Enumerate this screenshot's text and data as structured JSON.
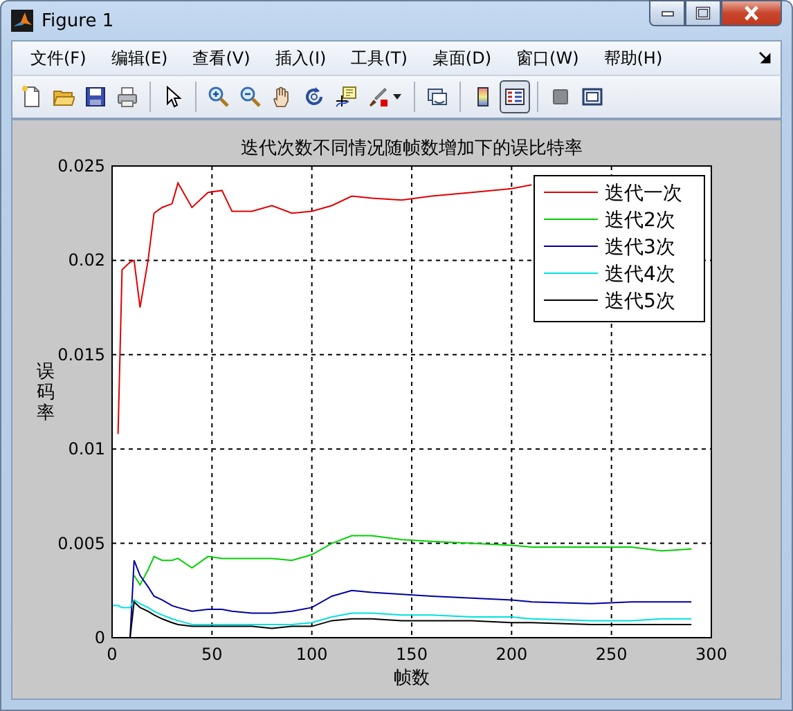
{
  "window": {
    "title": "Figure 1"
  },
  "menu": [
    "文件(F)",
    "编辑(E)",
    "查看(V)",
    "插入(I)",
    "工具(T)",
    "桌面(D)",
    "窗口(W)",
    "帮助(H)"
  ],
  "toolbar": [
    {
      "pressed": false
    },
    {
      "pressed": false
    },
    {
      "pressed": false
    },
    {
      "pressed": false
    },
    {
      "pressed": false
    },
    {
      "pressed": false
    },
    {
      "pressed": false
    },
    {
      "pressed": false
    },
    {
      "pressed": false
    },
    {
      "pressed": false
    },
    {
      "pressed": false
    },
    {
      "pressed": false
    },
    {
      "pressed": false
    },
    {
      "pressed": true
    },
    {
      "pressed": false
    },
    {
      "pressed": false
    }
  ],
  "axes": {
    "chart_data": {
      "type": "line",
      "title": "迭代次数不同情况随帧数增加下的误比特率",
      "xlabel": "帧数",
      "ylabel": "误码率",
      "x": [
        0,
        3,
        5,
        8,
        9,
        11,
        14,
        18,
        21,
        25,
        30,
        33,
        40,
        48,
        55,
        60,
        70,
        80,
        90,
        100,
        110,
        120,
        130,
        145,
        160,
        180,
        200,
        210,
        240,
        260,
        275,
        290
      ],
      "series": [
        {
          "name": "迭代一次",
          "color": "#e00000",
          "values": [
            null,
            0.0108,
            0.0195,
            0.0198,
            0.0199,
            0.02,
            0.0175,
            0.02,
            0.0225,
            0.0228,
            0.023,
            0.0241,
            0.0228,
            0.0236,
            0.0237,
            0.0226,
            0.0226,
            0.0229,
            0.0225,
            0.0226,
            0.0229,
            0.0234,
            0.0233,
            0.0232,
            0.0234,
            0.0236,
            0.0238,
            0.024,
            null,
            null,
            null,
            null
          ]
        },
        {
          "name": "迭代2次",
          "color": "#00d000",
          "values": [
            null,
            null,
            null,
            null,
            null,
            0.0033,
            0.0028,
            0.0036,
            0.0043,
            0.0041,
            0.0041,
            0.0042,
            0.0037,
            0.0043,
            0.0042,
            0.0042,
            0.0042,
            0.0042,
            0.0041,
            0.0044,
            0.005,
            0.0054,
            0.0054,
            0.0052,
            0.0051,
            0.005,
            0.0049,
            0.0048,
            0.0048,
            0.0048,
            0.0046,
            0.0047
          ]
        },
        {
          "name": "迭代3次",
          "color": "#0000a0",
          "values": [
            null,
            null,
            null,
            null,
            0,
            0.0041,
            0.0033,
            0.0027,
            0.0022,
            0.002,
            0.0017,
            0.0016,
            0.0014,
            0.0015,
            0.0015,
            0.0014,
            0.0013,
            0.0013,
            0.0014,
            0.0016,
            0.0022,
            0.0025,
            0.0024,
            0.0023,
            0.0022,
            0.0021,
            0.002,
            0.0019,
            0.0018,
            0.0019,
            0.0019,
            0.0019
          ]
        },
        {
          "name": "迭代4次",
          "color": "#00e0e0",
          "values": [
            0.0017,
            0.0017,
            0.0016,
            0.0016,
            0.0016,
            0.002,
            0.0018,
            0.0016,
            0.0014,
            0.0012,
            0.001,
            0.0009,
            0.0007,
            0.0007,
            0.0007,
            0.0007,
            0.0007,
            0.0007,
            0.0007,
            0.0008,
            0.0011,
            0.0013,
            0.0013,
            0.0012,
            0.0012,
            0.0011,
            0.0011,
            0.001,
            0.0009,
            0.0009,
            0.001,
            0.001
          ]
        },
        {
          "name": "迭代5次",
          "color": "#000000",
          "values": [
            null,
            null,
            null,
            null,
            0,
            0.0019,
            0.0016,
            0.0014,
            0.0012,
            0.001,
            0.0008,
            0.0007,
            0.0006,
            0.0006,
            0.0006,
            0.0006,
            0.0006,
            0.0005,
            0.0006,
            0.0006,
            0.0009,
            0.001,
            0.001,
            0.0009,
            0.0009,
            0.0009,
            0.0008,
            0.0008,
            0.0007,
            0.0007,
            0.0007,
            0.0007
          ]
        }
      ],
      "grid": true,
      "legend": true,
      "xlim": [
        0,
        300
      ],
      "ylim": [
        0,
        0.025
      ],
      "xticks": [
        0,
        50,
        100,
        150,
        200,
        250,
        300
      ],
      "yticks": [
        {
          "value": 0,
          "label": "0"
        },
        {
          "value": 0.005,
          "label": "0.005"
        },
        {
          "value": 0.01,
          "label": "0.01"
        },
        {
          "value": 0.015,
          "label": "0.015"
        },
        {
          "value": 0.02,
          "label": "0.02"
        },
        {
          "value": 0.025,
          "label": "0.025"
        }
      ]
    }
  }
}
